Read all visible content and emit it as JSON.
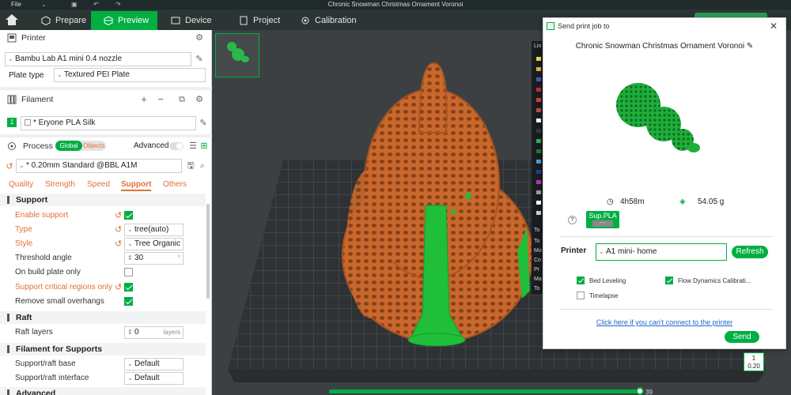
{
  "titlebar": {
    "file_label": "File",
    "window_title": "Chronic Snowman Christmas Ornament Voronoi"
  },
  "toolbar": {
    "tabs": [
      {
        "label": "Prepare",
        "icon": "cube-icon"
      },
      {
        "label": "Preview",
        "icon": "preview-icon"
      },
      {
        "label": "Device",
        "icon": "device-icon"
      },
      {
        "label": "Project",
        "icon": "project-icon"
      },
      {
        "label": "Calibration",
        "icon": "calibration-icon"
      }
    ],
    "active_tab": "Preview",
    "accent": "#00ae42"
  },
  "left_panel": {
    "printer": {
      "section_label": "Printer",
      "model": "Bambu Lab A1 mini 0.4 nozzle",
      "plate_type_label": "Plate type",
      "plate_type": "Textured PEI Plate"
    },
    "filament": {
      "section_label": "Filament",
      "slot": "1",
      "name": "* Eryone PLA Silk"
    },
    "process": {
      "section_label": "Process",
      "toggle_global": "Global",
      "toggle_objects": "Objects",
      "advanced_label": "Advanced",
      "profile": "* 0.20mm Standard @BBL A1M",
      "tabs": [
        "Quality",
        "Strength",
        "Speed",
        "Support",
        "Others"
      ],
      "active_tab": "Support"
    },
    "support": {
      "title": "Support",
      "rows": [
        {
          "name": "Enable support",
          "value": ""
        },
        {
          "name": "Type",
          "value": "tree(auto)"
        },
        {
          "name": "Style",
          "value": "Tree Organic"
        },
        {
          "name": "Threshold angle",
          "value": "30",
          "unit": "°"
        },
        {
          "name": "On build plate only",
          "value": ""
        },
        {
          "name": "Support critical regions only",
          "value": ""
        },
        {
          "name": "Remove small overhangs",
          "value": ""
        }
      ]
    },
    "raft": {
      "title": "Raft",
      "rows": [
        {
          "name": "Raft layers",
          "value": "0",
          "unit": "layers"
        }
      ]
    },
    "filament_supports": {
      "title": "Filament for Supports",
      "rows": [
        {
          "name": "Support/raft base",
          "value": "Default"
        },
        {
          "name": "Support/raft interface",
          "value": "Default"
        }
      ]
    },
    "advanced_title": "Advanced"
  },
  "dialog": {
    "header": "Send print job to",
    "close": "✕",
    "model_title": "Chronic Snowman Christmas Ornament Voronoi",
    "time": "4h58m",
    "weight": "54.05 g",
    "help": "?",
    "filament_pill": "Sup.PLA",
    "filament_pill_sub": "- -",
    "printer_label": "Printer",
    "printer_value": "A1 mini- home",
    "refresh_label": "Refresh",
    "options": [
      {
        "label": "Bed Leveling",
        "checked": true
      },
      {
        "label": "Flow Dynamics Calibrati...",
        "checked": true
      },
      {
        "label": "Timelapse",
        "checked": false
      }
    ],
    "link": "Click here if you can't connect to the printer",
    "send_label": "Send"
  },
  "viewport": {
    "legend_header": "Lin",
    "legend_swatches": [
      "#f5d84a",
      "#e4b53a",
      "#4060c0",
      "#c03030",
      "#d04040",
      "#c05050",
      "#ffffff",
      "#3a3a3a",
      "#2bb84a",
      "#1f7a35",
      "#4aa0e0",
      "#2040a0",
      "#c030c0",
      "#a0a0a0",
      "#ffffff",
      "#d0d0d0"
    ],
    "legend_texts": [
      "To",
      "To",
      "Mo",
      "Co",
      "Pr",
      "Ma",
      "To"
    ],
    "layer_top": "1",
    "layer_height": "0.20",
    "layer_slider": "39"
  }
}
